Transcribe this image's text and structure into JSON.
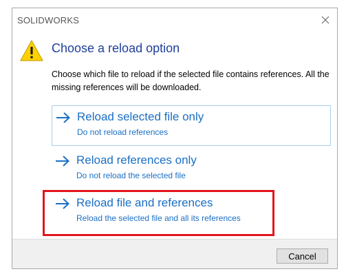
{
  "window": {
    "title": "SOLIDWORKS",
    "close_icon": "close-icon"
  },
  "content": {
    "icon": "warning-icon",
    "heading": "Choose a reload option",
    "description": "Choose which file to reload if the selected file contains references. All the missing references will be downloaded."
  },
  "options": [
    {
      "icon": "arrow-right-icon",
      "title": "Reload selected file only",
      "subtitle": "Do not reload references"
    },
    {
      "icon": "arrow-right-icon",
      "title": "Reload references only",
      "subtitle": "Do not reload the selected file"
    },
    {
      "icon": "arrow-right-icon",
      "title": "Reload file and references",
      "subtitle": "Reload the selected file and all its references"
    }
  ],
  "footer": {
    "cancel_label": "Cancel"
  },
  "colors": {
    "heading": "#1e3f9a",
    "option_text": "#1a6fc4",
    "highlight_border": "#e3141c",
    "warning_fill": "#ffd200"
  }
}
